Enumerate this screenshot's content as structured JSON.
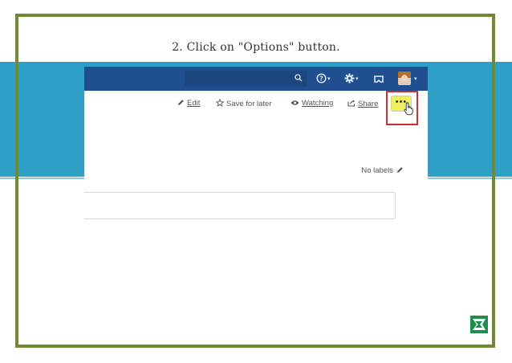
{
  "tutorial": {
    "caption": "2. Click on \"Options\" button."
  },
  "toolbar": {
    "edit_label": "Edit",
    "save_for_later_label": "Save for later",
    "watching_label": "Watching",
    "share_label": "Share",
    "options_label": "•••"
  },
  "labels": {
    "text": "No labels"
  },
  "colors": {
    "frame": "#6f8a32",
    "band": "#2e9fc7",
    "topbar": "#1f4f8f",
    "highlight": "#d22c2c",
    "options_button": "#eef060"
  },
  "icons": [
    "search-icon",
    "help-icon",
    "gear-icon",
    "notifications-icon",
    "user-avatar",
    "pencil-icon",
    "star-icon",
    "eye-icon",
    "share-icon",
    "hand-cursor-icon",
    "brand-logo-icon"
  ]
}
